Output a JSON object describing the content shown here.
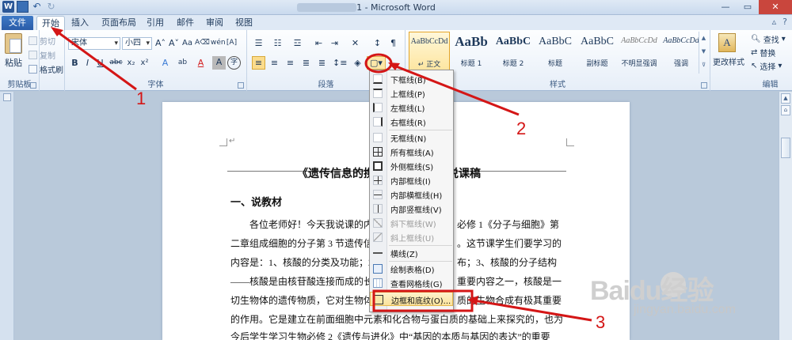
{
  "window": {
    "title": "1 - Microsoft Word",
    "app_icon": "W"
  },
  "tabs": {
    "file": "文件",
    "items": [
      "开始",
      "插入",
      "页面布局",
      "引用",
      "邮件",
      "审阅",
      "视图"
    ],
    "active": "开始"
  },
  "clipboard": {
    "paste": "粘贴",
    "cut": "剪切",
    "copy": "复制",
    "format_painter": "格式刷",
    "label": "剪贴板"
  },
  "font": {
    "name": "宋体",
    "size": "小四",
    "label": "字体",
    "buttons": [
      "B",
      "I",
      "U",
      "abc",
      "x₂",
      "x²",
      "A",
      "A",
      "A",
      "A"
    ]
  },
  "paragraph": {
    "label": "段落"
  },
  "styles": {
    "label": "样式",
    "items": [
      {
        "sample": "AaBbCcDd",
        "name": "↵ 正文",
        "size": "10px"
      },
      {
        "sample": "AaBb",
        "name": "标题 1",
        "size": "17px"
      },
      {
        "sample": "AaBbC",
        "name": "标题 2",
        "size": "14px"
      },
      {
        "sample": "AaBbC",
        "name": "标题",
        "size": "14px"
      },
      {
        "sample": "AaBbC",
        "name": "副标题",
        "size": "14px"
      },
      {
        "sample": "AaBbCcDd",
        "name": "不明显强调",
        "size": "10px"
      },
      {
        "sample": "AaBbCcDd",
        "name": "强调",
        "size": "10px"
      }
    ],
    "change_styles": "更改样式"
  },
  "editing": {
    "label": "编辑",
    "find": "查找",
    "replace": "替换",
    "select": "选择"
  },
  "border_menu": {
    "items": [
      {
        "label": "下框线(B)",
        "icon": "b-bottom",
        "disabled": false
      },
      {
        "label": "上框线(P)",
        "icon": "b-top",
        "disabled": false
      },
      {
        "label": "左框线(L)",
        "icon": "b-left",
        "disabled": false
      },
      {
        "label": "右框线(R)",
        "icon": "b-right",
        "disabled": false
      },
      {
        "label": "无框线(N)",
        "icon": "",
        "disabled": false
      },
      {
        "label": "所有框线(A)",
        "icon": "b-all",
        "disabled": false
      },
      {
        "label": "外侧框线(S)",
        "icon": "b-outer",
        "disabled": false
      },
      {
        "label": "内部框线(I)",
        "icon": "b-inner",
        "disabled": false
      },
      {
        "label": "内部横框线(H)",
        "icon": "b-ih",
        "disabled": false
      },
      {
        "label": "内部竖框线(V)",
        "icon": "b-iv",
        "disabled": false
      },
      {
        "label": "斜下框线(W)",
        "icon": "b-diag",
        "disabled": true
      },
      {
        "label": "斜上框线(U)",
        "icon": "b-diag2",
        "disabled": true
      },
      {
        "label": "横线(Z)",
        "icon": "b-hline",
        "disabled": false
      },
      {
        "label": "绘制表格(D)",
        "icon": "b-draw",
        "disabled": false
      },
      {
        "label": "查看网格线(G)",
        "icon": "b-grid",
        "disabled": false
      },
      {
        "label": "边框和底纹(O)...",
        "icon": "b-shade",
        "disabled": false
      }
    ]
  },
  "document": {
    "title": "《遗传信息的携",
    "title_tail": "说课稿",
    "heading": "一、说教材",
    "lines": [
      {
        "left": "各位老师好！今天我说课的内",
        "right": "必修 1《分子与细胞》第"
      },
      {
        "left": "二章组成细胞的分子第 3 节遗传信",
        "right": "。这节课学生们要学习的"
      },
      {
        "left": "内容是：1、核酸的分类及功能；2",
        "right": "布；3、核酸的分子结构"
      },
      {
        "left": "——核酸是由核苷酸连接而成的长",
        "right": "重要内容之一，核酸是一"
      },
      {
        "left": "切生物体的遗传物质，它对生物体",
        "right": "质的生物合成有极其重要"
      },
      {
        "left": "的作用。它是建立在前面细胞中元素和化合物与蛋白质的基础上来探究的，也为",
        "right": ""
      },
      {
        "left": "今后学生学习生物必修 2《遗传与进化》中“基因的本质与基因的表达”的重要",
        "right": ""
      }
    ]
  },
  "annotations": {
    "markers": [
      "1",
      "2",
      "3"
    ],
    "color": "#d41616"
  },
  "watermark": {
    "brand": "Baidu经验",
    "url": "jingyan.baidu.com"
  }
}
